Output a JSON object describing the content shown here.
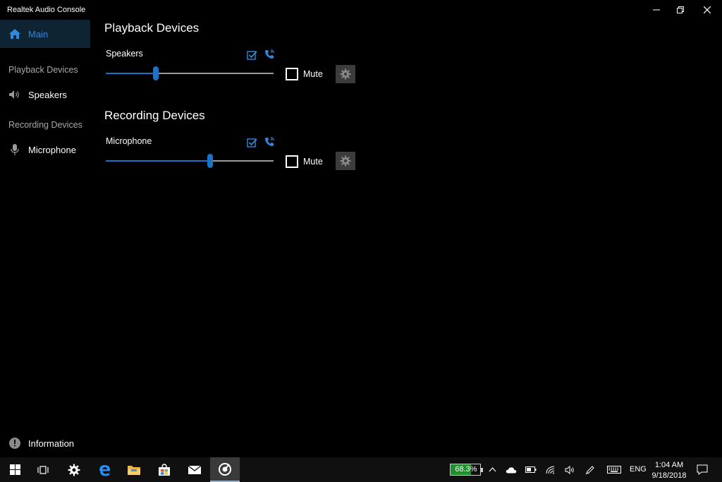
{
  "window": {
    "title": "Realtek Audio Console"
  },
  "sidebar": {
    "main_label": "Main",
    "playback_header": "Playback Devices",
    "speakers_label": "Speakers",
    "recording_header": "Recording Devices",
    "microphone_label": "Microphone",
    "information_label": "Information"
  },
  "main": {
    "playback": {
      "title": "Playback Devices",
      "device": "Speakers",
      "volume_fraction": 0.3,
      "mute_label": "Mute",
      "muted": false
    },
    "recording": {
      "title": "Recording Devices",
      "device": "Microphone",
      "volume_fraction": 0.62,
      "mute_label": "Mute",
      "muted": false
    }
  },
  "taskbar": {
    "battery_percent": "68.3%",
    "battery_fraction": 0.683,
    "language": "ENG",
    "time": "1:04 AM",
    "date": "9/18/2018"
  },
  "colors": {
    "accent": "#1a73c8",
    "selected_bg": "#0f2433",
    "battery_green": "#1f8f2e"
  }
}
